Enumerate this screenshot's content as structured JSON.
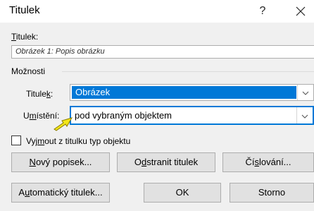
{
  "dialog": {
    "title": "Titulek",
    "help_glyph": "?",
    "close_glyph": "✕"
  },
  "caption": {
    "label": "Titulek:",
    "value": "Obrázek 1: Popis obrázku"
  },
  "options": {
    "group_label": "Možnosti",
    "label_field": {
      "label": "Titulek:",
      "value": "Obrázek"
    },
    "position_field": {
      "label": "Umístění:",
      "value": "pod vybraným objektem"
    },
    "exclude_checkbox": {
      "label": "Vyjmout z titulku typ objektu",
      "checked": false
    }
  },
  "buttons": {
    "new_label": "Nový popisek...",
    "delete_label": "Odstranit titulek",
    "numbering": "Číslování...",
    "autocaption": "Automatický titulek...",
    "ok": "OK",
    "cancel": "Storno"
  },
  "colors": {
    "selection": "#0078d7",
    "focus_border": "#0078d7",
    "annotation_arrow": "#f3e61a"
  }
}
